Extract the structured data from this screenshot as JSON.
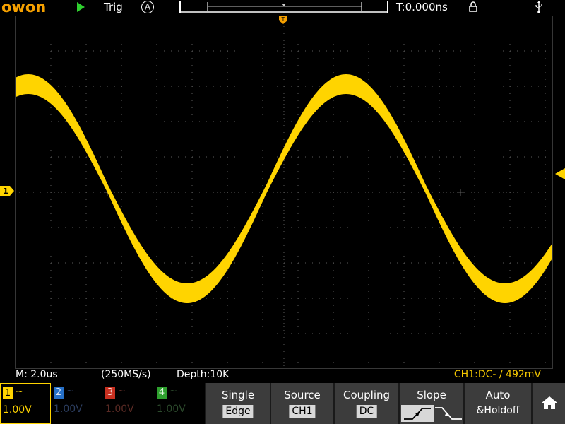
{
  "brand": {
    "logo_text": "owon"
  },
  "topbar": {
    "trigger_status": "Trig",
    "trigger_mode_icon": "A",
    "time_offset": "T:0.000ns",
    "icons": [
      "run-icon",
      "lock-icon",
      "usb-icon"
    ]
  },
  "status": {
    "timebase": "M: 2.0us",
    "sample_rate": "(250MS/s)",
    "depth": "Depth:10K",
    "trigger_info": "CH1:DC- ∕ 492mV"
  },
  "channels": [
    {
      "number": "1",
      "coupling": "~",
      "scale": "1.00V",
      "color": "#ffd400",
      "active": true
    },
    {
      "number": "2",
      "coupling": "~",
      "scale": "1.00V",
      "color": "#2670c8",
      "active": false
    },
    {
      "number": "3",
      "coupling": "~",
      "scale": "1.00V",
      "color": "#c83020",
      "active": false
    },
    {
      "number": "4",
      "coupling": "~",
      "scale": "1.00V",
      "color": "#2ea02e",
      "active": false
    }
  ],
  "menu": {
    "trigger_type": {
      "title": "Single",
      "value": "Edge"
    },
    "source": {
      "title": "Source",
      "value": "CH1"
    },
    "coupling": {
      "title": "Coupling",
      "value": "DC"
    },
    "slope": {
      "title": "Slope"
    },
    "mode": {
      "title": "Auto",
      "subtitle": "&Holdoff"
    }
  },
  "markers": {
    "channel1_label": "1",
    "trigger_position_label": "T"
  },
  "colors": {
    "accent": "#f5a000",
    "trace_ch1": "#ffd400",
    "grid": "#5a5a5a",
    "menu_bg": "#3c3c3c"
  }
}
